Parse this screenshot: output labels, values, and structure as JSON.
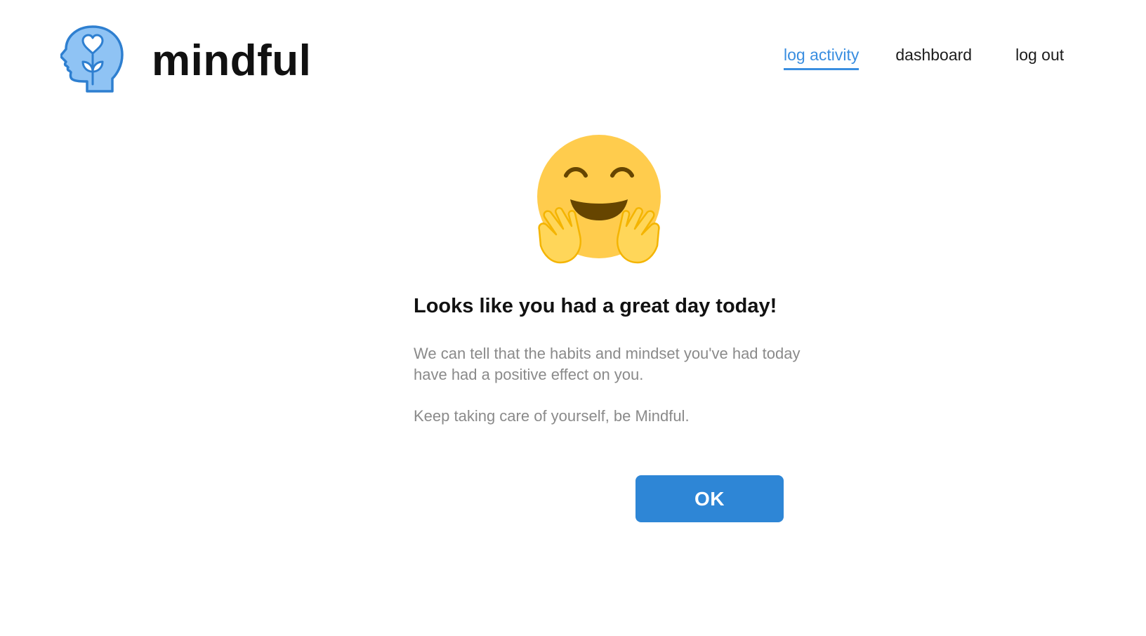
{
  "header": {
    "brand": "mindful",
    "logo_icon": "head-with-heart-plant-icon"
  },
  "nav": {
    "items": [
      {
        "label": "log activity",
        "active": true
      },
      {
        "label": "dashboard",
        "active": false
      },
      {
        "label": "log out",
        "active": false
      }
    ]
  },
  "main": {
    "emoji_icon": "hugging-face-emoji-icon",
    "heading": "Looks like you had a great day today!",
    "message": "We can tell that the habits and mindset you've had today have had a positive effect on you.",
    "closing": "Keep taking care of yourself, be Mindful.",
    "ok_label": "OK"
  },
  "colors": {
    "accent": "#3a8ee0",
    "button": "#2e86d6",
    "logo_fill": "#8fc3f4",
    "emoji_yellow": "#ffcc4d",
    "body_text": "#8a8a8a"
  }
}
